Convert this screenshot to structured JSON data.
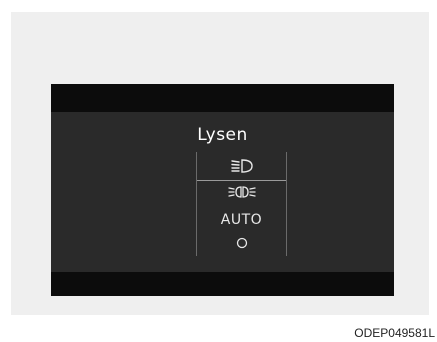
{
  "screen": {
    "title": "Lysen",
    "menu": [
      {
        "type": "icon",
        "icon": "headlight-icon",
        "selected": true
      },
      {
        "type": "icon",
        "icon": "parking-light-icon"
      },
      {
        "type": "text",
        "label": "AUTO"
      },
      {
        "type": "icon",
        "icon": "lights-off-icon"
      }
    ]
  },
  "figure_code": "ODEP049581L"
}
